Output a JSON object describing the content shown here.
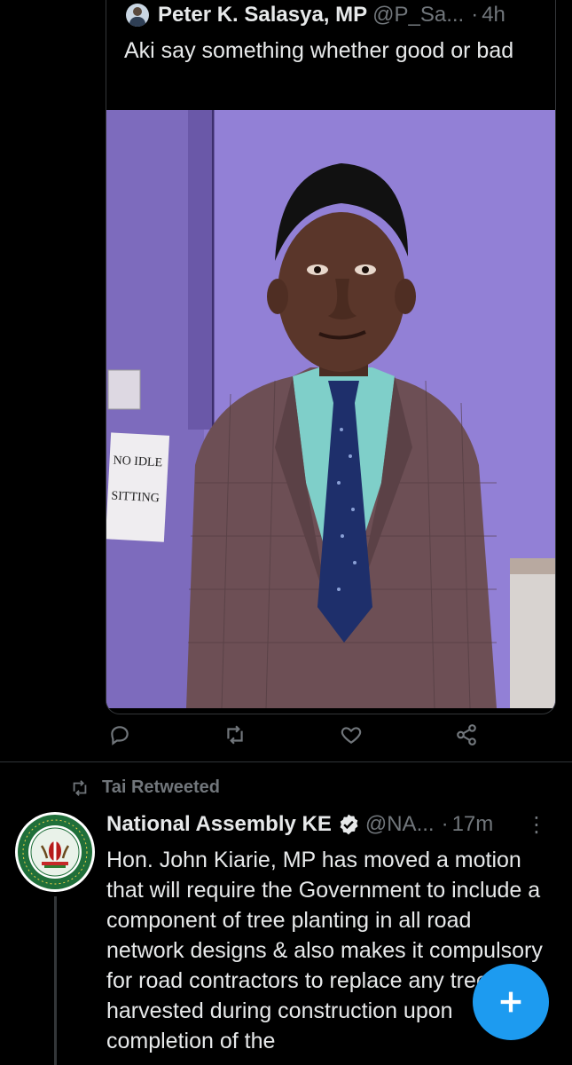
{
  "quoted_tweet": {
    "author_name": "Peter K. Salasya, MP",
    "handle": "@P_Sa...",
    "separator": "·",
    "time": "4h",
    "text": "Aki say something whether good or bad",
    "sign_text": "NO IDLE SITTING",
    "avatar_icon": "user-avatar-photo"
  },
  "actions": {
    "reply_icon": "reply-icon",
    "retweet_icon": "retweet-icon",
    "like_icon": "heart-icon",
    "share_icon": "share-icon"
  },
  "retweet_context": {
    "label": "Tai Retweeted"
  },
  "tweet": {
    "author_name": "National Assembly KE",
    "verified": true,
    "handle": "@NA...",
    "separator": "·",
    "time": "17m",
    "more_label": "⋮",
    "text": "Hon. John Kiarie, MP has moved a motion that will require the Government to include a component of tree planting in all road network designs & also makes it compulsory for road contractors to replace any tree harvested during construction upon completion of the",
    "avatar_icon": "national-assembly-seal"
  },
  "compose_button": {
    "icon": "plus-icon"
  },
  "colors": {
    "background": "#000000",
    "text_primary": "#e7e9ea",
    "text_secondary": "#71767b",
    "accent": "#1d9bf0",
    "border": "#2f3336"
  }
}
